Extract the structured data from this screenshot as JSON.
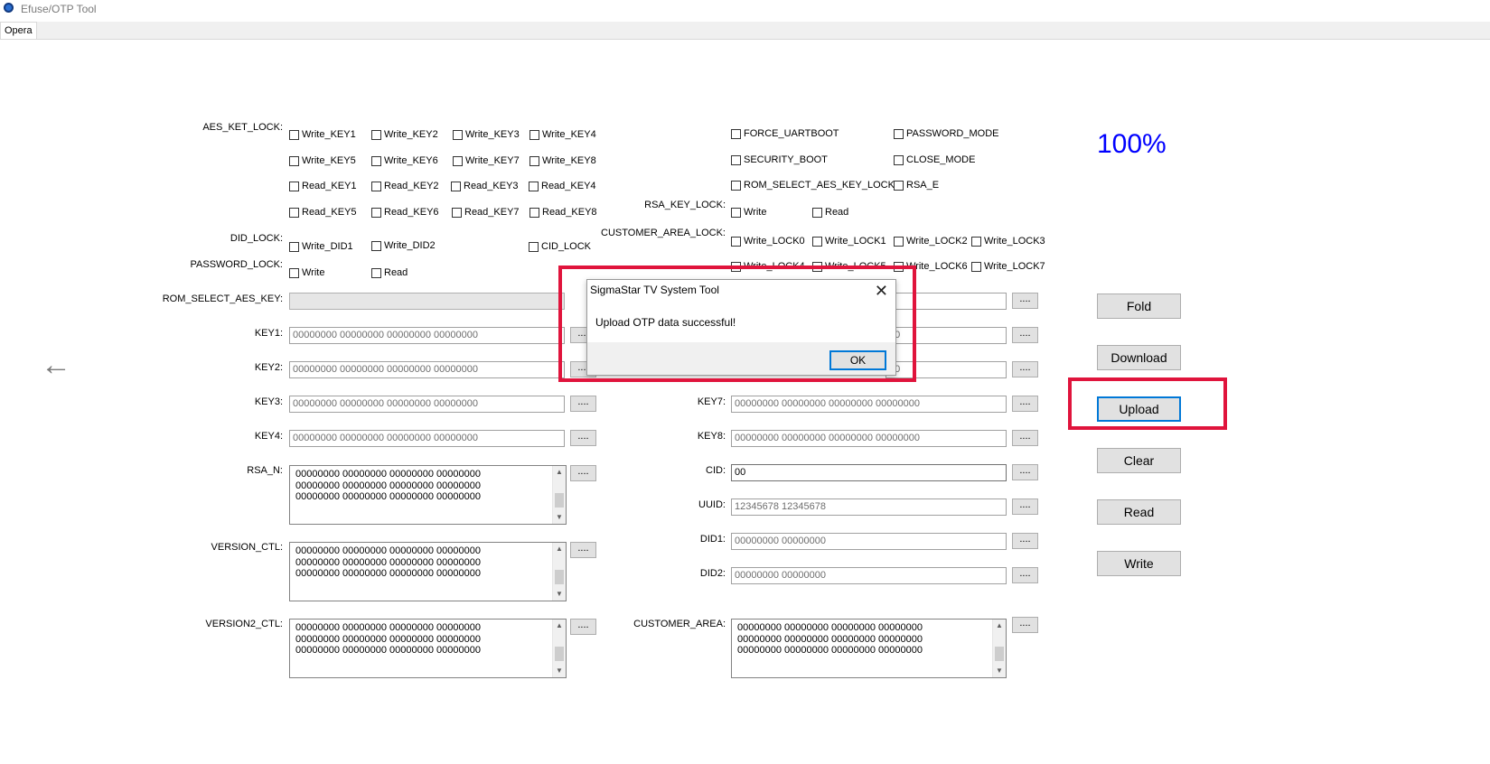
{
  "window": {
    "title": "Efuse/OTP Tool",
    "tab": "Opera"
  },
  "progress": {
    "text": "100%",
    "color": "#0000ff"
  },
  "left_labels": {
    "aes_lock": "AES_KET_LOCK:",
    "did_lock": "DID_LOCK:",
    "password_lock": "PASSWORD_LOCK:",
    "rom_select": "ROM_SELECT_AES_KEY:",
    "key1": "KEY1:",
    "key2": "KEY2:",
    "key3": "KEY3:",
    "key4": "KEY4:",
    "rsa_n": "RSA_N:",
    "version_ctl": "VERSION_CTL:",
    "version2_ctl": "VERSION2_CTL:"
  },
  "aes_lock_checks": [
    "Write_KEY1",
    "Write_KEY2",
    "Write_KEY3",
    "Write_KEY4",
    "Write_KEY5",
    "Write_KEY6",
    "Write_KEY7",
    "Write_KEY8",
    "Read_KEY1",
    "Read_KEY2",
    "Read_KEY3",
    "Read_KEY4",
    "Read_KEY5",
    "Read_KEY6",
    "Read_KEY7",
    "Read_KEY8"
  ],
  "did_lock_checks": [
    "Write_DID1",
    "Write_DID2",
    "CID_LOCK"
  ],
  "password_lock_checks": [
    "Write",
    "Read"
  ],
  "right_checks": [
    "FORCE_UARTBOOT",
    "PASSWORD_MODE",
    "SECURITY_BOOT",
    "CLOSE_MODE",
    "ROM_SELECT_AES_KEY_LOCK",
    "RSA_E"
  ],
  "right_labels": {
    "rsa_key_lock": "RSA_KEY_LOCK:",
    "customer_area_lock": "CUSTOMER_AREA_LOCK:",
    "key7": "KEY7:",
    "key8": "KEY8:",
    "cid": "CID:",
    "uuid": "UUID:",
    "did1": "DID1:",
    "did2": "DID2:",
    "customer_area": "CUSTOMER_AREA:"
  },
  "rsa_key_lock_checks": [
    "Write",
    "Read"
  ],
  "customer_lock_checks": [
    "Write_LOCK0",
    "Write_LOCK1",
    "Write_LOCK2",
    "Write_LOCK3",
    "Write_LOCK4",
    "Write_LOCK5",
    "Write_LOCK6",
    "Write_LOCK7"
  ],
  "fields": {
    "key1": "00000000 00000000 00000000 00000000",
    "key2": "00000000 00000000 00000000 00000000",
    "key3": "00000000 00000000 00000000 00000000",
    "key4": "00000000 00000000 00000000 00000000",
    "key5_tail": "00",
    "key6_tail": "00",
    "key7": "00000000 00000000 00000000 00000000",
    "key8": "00000000 00000000 00000000 00000000",
    "cid": "00",
    "uuid": "12345678 12345678",
    "did1": "00000000 00000000",
    "did2": "00000000 00000000"
  },
  "textarea_line": "00000000 00000000 00000000 00000000",
  "dots_label": "....",
  "buttons": {
    "fold": "Fold",
    "download": "Download",
    "upload": "Upload",
    "clear": "Clear",
    "read": "Read",
    "write": "Write"
  },
  "dialog": {
    "title": "SigmaStar TV System Tool",
    "message": "Upload OTP data successful!",
    "ok": "OK",
    "close": "✕"
  },
  "icons": {
    "back": "←"
  },
  "colors": {
    "highlight": "#e0143c",
    "focus": "#0078d7"
  }
}
